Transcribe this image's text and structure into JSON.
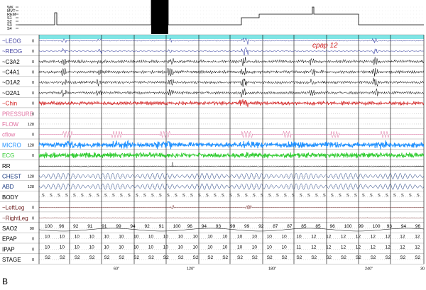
{
  "hypnogram": {
    "stage_labels": [
      "WK",
      "MVT",
      "REM",
      "S1",
      "S2",
      "S3",
      "S4"
    ]
  },
  "annotation": "cpap 12",
  "figure_label": "B",
  "colors": {
    "eog": "#1f2a9a",
    "eeg": "#000000",
    "chin": "#d32020",
    "pressure": "#e070a0",
    "flow": "#e070a0",
    "micro": "#1e90ff",
    "ecg": "#30cc30",
    "resp": "#1a3a80",
    "leg": "#6b1a1a",
    "header_band": "#7fe5e5",
    "divider": "#000000"
  },
  "channels": [
    {
      "key": "leog",
      "label": "~LEOG",
      "scale": "0",
      "color": "#4040a0"
    },
    {
      "key": "reog",
      "label": "~REOG",
      "scale": "0",
      "color": "#4040a0"
    },
    {
      "key": "c3a2",
      "label": "~C3A2",
      "scale": "0",
      "color": "#000000"
    },
    {
      "key": "c4a1",
      "label": "~C4A1",
      "scale": "0",
      "color": "#000000"
    },
    {
      "key": "o1a2",
      "label": "~O1A2",
      "scale": "0",
      "color": "#000000"
    },
    {
      "key": "o2a1",
      "label": "~O2A1",
      "scale": "0",
      "color": "#000000"
    },
    {
      "key": "chin",
      "label": "~Chin",
      "scale": "0",
      "color": "#d32020"
    },
    {
      "key": "pressure",
      "label": "PRESSURE",
      "scale": "0",
      "color": "#e070a0"
    },
    {
      "key": "flow",
      "label": "FLOW",
      "scale": "128",
      "color": "#e070a0"
    },
    {
      "key": "cflow",
      "label": "cflow",
      "scale": "0",
      "color": "#e070a0"
    },
    {
      "key": "micro",
      "label": "MICRO",
      "scale": "128",
      "color": "#1e90ff"
    },
    {
      "key": "ecg",
      "label": "ECG",
      "scale": "0",
      "color": "#30cc30"
    },
    {
      "key": "rr",
      "label": "RR",
      "scale": "",
      "color": "#000000"
    },
    {
      "key": "chest",
      "label": "CHEST",
      "scale": "128",
      "color": "#1a3a80"
    },
    {
      "key": "abd",
      "label": "ABD",
      "scale": "128",
      "color": "#1a3a80"
    },
    {
      "key": "body",
      "label": "BODY",
      "scale": "",
      "color": "#000000"
    },
    {
      "key": "leftleg",
      "label": "~LeftLeg",
      "scale": "0",
      "color": "#6b1a1a"
    },
    {
      "key": "rightleg",
      "label": "~RightLeg",
      "scale": "0",
      "color": "#6b1a1a"
    },
    {
      "key": "sao2",
      "label": "SAO2",
      "scale": "90",
      "color": "#000000"
    },
    {
      "key": "epap",
      "label": "EPAP",
      "scale": "0",
      "color": "#000000"
    },
    {
      "key": "ipap",
      "label": "IPAP",
      "scale": "0",
      "color": "#000000"
    },
    {
      "key": "stage",
      "label": "STAGE",
      "scale": "0",
      "color": "#000000"
    }
  ],
  "sao2_values": [
    "100",
    "96",
    "92",
    "91",
    "91",
    "99",
    "94",
    "92",
    "91",
    "100",
    "96",
    "94",
    "93",
    "99",
    "99",
    "92",
    "87",
    "87",
    "85",
    "85",
    "96",
    "100",
    "99",
    "100",
    "93",
    "94",
    "96"
  ],
  "epap_values": [
    "10",
    "10",
    "10",
    "10",
    "10",
    "10",
    "10",
    "10",
    "10",
    "10",
    "10",
    "10",
    "10",
    "10",
    "10",
    "10",
    "10",
    "10",
    "12",
    "12",
    "12",
    "12",
    "12",
    "12",
    "12",
    "12"
  ],
  "ipap_values": [
    "10",
    "10",
    "10",
    "10",
    "10",
    "10",
    "10",
    "10",
    "10",
    "10",
    "10",
    "10",
    "10",
    "10",
    "10",
    "10",
    "10",
    "11",
    "12",
    "12",
    "12",
    "12",
    "12",
    "12",
    "12",
    "12"
  ],
  "stage_values": [
    "S2",
    "S2",
    "S2",
    "S2",
    "S2",
    "S2",
    "S2",
    "S2",
    "S2",
    "S2",
    "S2",
    "S2",
    "S2",
    "S2",
    "S2",
    "S2",
    "S2",
    "S2",
    "S2",
    "S2",
    "S2",
    "S2",
    "S2",
    "S2",
    "S2",
    "S2"
  ],
  "time_ticks": [
    "60\"",
    "120\"",
    "180\"",
    "240\"",
    "30"
  ]
}
